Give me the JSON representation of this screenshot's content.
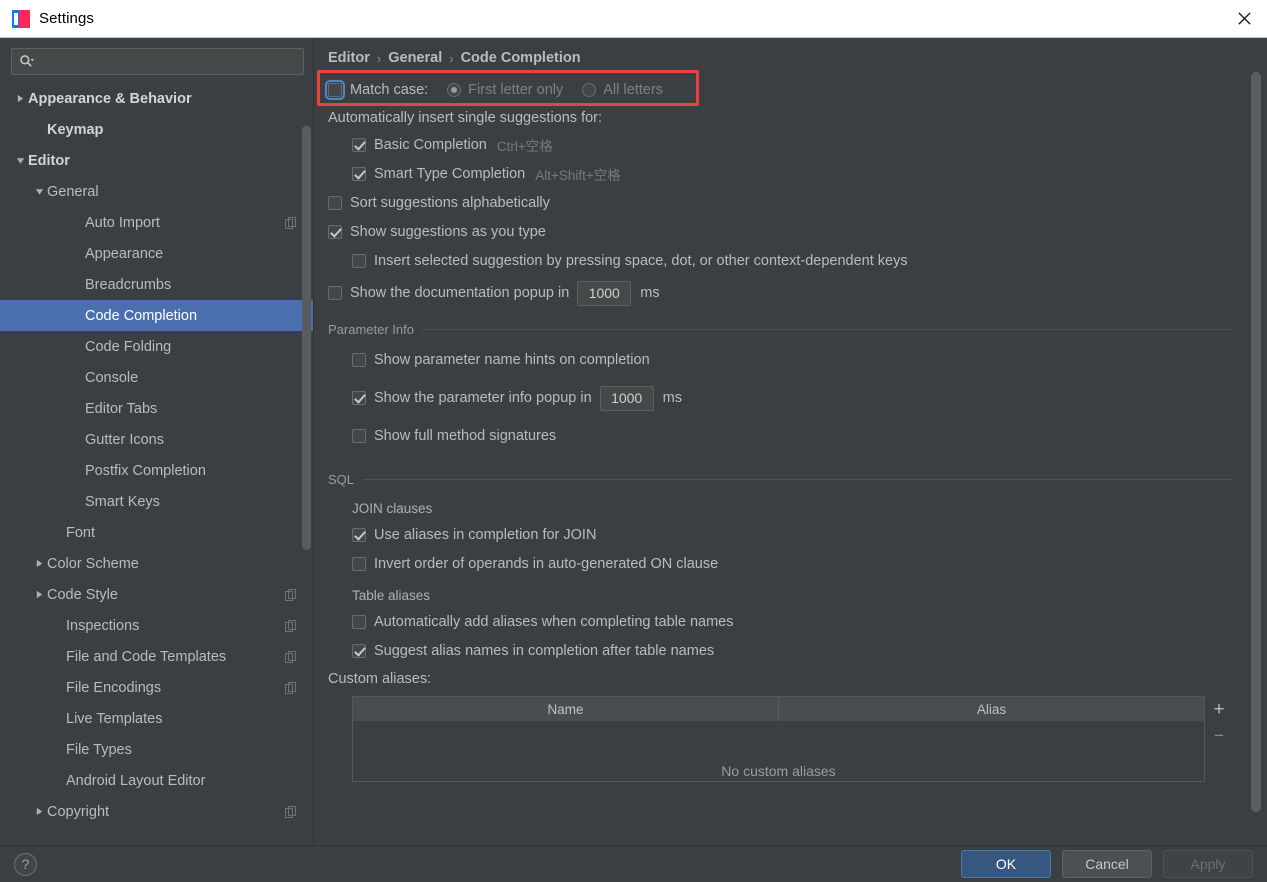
{
  "window": {
    "title": "Settings",
    "app_icon": "intellij-idea-icon",
    "close_icon": "close-icon"
  },
  "sidebar": {
    "search": {
      "placeholder": "",
      "value": "",
      "icon": "search-icon"
    },
    "items": [
      {
        "label": "Appearance & Behavior",
        "indent": 0,
        "twisty": "collapsed",
        "bold": true,
        "selected": false,
        "copyable": false
      },
      {
        "label": "Keymap",
        "indent": 1,
        "twisty": "none",
        "bold": true,
        "selected": false,
        "copyable": false
      },
      {
        "label": "Editor",
        "indent": 0,
        "twisty": "expanded",
        "bold": true,
        "selected": false,
        "copyable": false
      },
      {
        "label": "General",
        "indent": 1,
        "twisty": "expanded",
        "bold": false,
        "selected": false,
        "copyable": false
      },
      {
        "label": "Auto Import",
        "indent": 3,
        "twisty": "none",
        "bold": false,
        "selected": false,
        "copyable": true
      },
      {
        "label": "Appearance",
        "indent": 3,
        "twisty": "none",
        "bold": false,
        "selected": false,
        "copyable": false
      },
      {
        "label": "Breadcrumbs",
        "indent": 3,
        "twisty": "none",
        "bold": false,
        "selected": false,
        "copyable": false
      },
      {
        "label": "Code Completion",
        "indent": 3,
        "twisty": "none",
        "bold": false,
        "selected": true,
        "copyable": false
      },
      {
        "label": "Code Folding",
        "indent": 3,
        "twisty": "none",
        "bold": false,
        "selected": false,
        "copyable": false
      },
      {
        "label": "Console",
        "indent": 3,
        "twisty": "none",
        "bold": false,
        "selected": false,
        "copyable": false
      },
      {
        "label": "Editor Tabs",
        "indent": 3,
        "twisty": "none",
        "bold": false,
        "selected": false,
        "copyable": false
      },
      {
        "label": "Gutter Icons",
        "indent": 3,
        "twisty": "none",
        "bold": false,
        "selected": false,
        "copyable": false
      },
      {
        "label": "Postfix Completion",
        "indent": 3,
        "twisty": "none",
        "bold": false,
        "selected": false,
        "copyable": false
      },
      {
        "label": "Smart Keys",
        "indent": 3,
        "twisty": "none",
        "bold": false,
        "selected": false,
        "copyable": false
      },
      {
        "label": "Font",
        "indent": 2,
        "twisty": "none",
        "bold": false,
        "selected": false,
        "copyable": false
      },
      {
        "label": "Color Scheme",
        "indent": 1,
        "twisty": "collapsed",
        "bold": false,
        "selected": false,
        "copyable": false
      },
      {
        "label": "Code Style",
        "indent": 1,
        "twisty": "collapsed",
        "bold": false,
        "selected": false,
        "copyable": true
      },
      {
        "label": "Inspections",
        "indent": 2,
        "twisty": "none",
        "bold": false,
        "selected": false,
        "copyable": true
      },
      {
        "label": "File and Code Templates",
        "indent": 2,
        "twisty": "none",
        "bold": false,
        "selected": false,
        "copyable": true
      },
      {
        "label": "File Encodings",
        "indent": 2,
        "twisty": "none",
        "bold": false,
        "selected": false,
        "copyable": true
      },
      {
        "label": "Live Templates",
        "indent": 2,
        "twisty": "none",
        "bold": false,
        "selected": false,
        "copyable": false
      },
      {
        "label": "File Types",
        "indent": 2,
        "twisty": "none",
        "bold": false,
        "selected": false,
        "copyable": false
      },
      {
        "label": "Android Layout Editor",
        "indent": 2,
        "twisty": "none",
        "bold": false,
        "selected": false,
        "copyable": false
      },
      {
        "label": "Copyright",
        "indent": 1,
        "twisty": "collapsed",
        "bold": false,
        "selected": false,
        "copyable": true
      }
    ]
  },
  "breadcrumb": {
    "parts": [
      "Editor",
      "General",
      "Code Completion"
    ],
    "separator": "›"
  },
  "main": {
    "match_case": {
      "label": "Match case:",
      "checked": false,
      "focused": true,
      "options": [
        {
          "label": "First letter only",
          "selected": true,
          "disabled": true
        },
        {
          "label": "All letters",
          "selected": false,
          "disabled": true
        }
      ]
    },
    "auto_insert_header": "Automatically insert single suggestions for:",
    "auto_insert_items": [
      {
        "label": "Basic Completion",
        "shortcut": "Ctrl+空格",
        "checked": true
      },
      {
        "label": "Smart Type Completion",
        "shortcut": "Alt+Shift+空格",
        "checked": true
      }
    ],
    "options": [
      {
        "label": "Sort suggestions alphabetically",
        "checked": false
      },
      {
        "label": "Show suggestions as you type",
        "checked": true
      }
    ],
    "insert_selected": {
      "label": "Insert selected suggestion by pressing space, dot, or other context-dependent keys",
      "checked": false
    },
    "doc_popup": {
      "label": "Show the documentation popup in",
      "checked": false,
      "value": "1000",
      "unit": "ms"
    },
    "parameter_info": {
      "title": "Parameter Info",
      "show_hints": {
        "label": "Show parameter name hints on completion",
        "checked": false
      },
      "popup": {
        "label": "Show the parameter info popup in",
        "checked": true,
        "value": "1000",
        "unit": "ms"
      },
      "full_signatures": {
        "label": "Show full method signatures",
        "checked": false
      }
    },
    "sql": {
      "title": "SQL",
      "join_clauses": {
        "title": "JOIN clauses",
        "items": [
          {
            "label": "Use aliases in completion for JOIN",
            "checked": true
          },
          {
            "label": "Invert order of operands in auto-generated ON clause",
            "checked": false
          }
        ]
      },
      "table_aliases": {
        "title": "Table aliases",
        "items": [
          {
            "label": "Automatically add aliases when completing table names",
            "checked": false
          },
          {
            "label": "Suggest alias names in completion after table names",
            "checked": true
          }
        ]
      },
      "custom_aliases": {
        "label": "Custom aliases:",
        "columns": [
          "Name",
          "Alias"
        ],
        "rows": [],
        "empty_text": "No custom aliases",
        "add_button": "+",
        "remove_button": "−"
      }
    }
  },
  "footer": {
    "help_label": "?",
    "ok_label": "OK",
    "cancel_label": "Cancel",
    "apply_label": "Apply",
    "apply_disabled": true
  },
  "colors": {
    "background": "#3c3f41",
    "selection": "#4b6eaf",
    "accent_button": "#365880",
    "annotation": "#e8413f",
    "text": "#bbbbbb",
    "text_dim": "#808080",
    "titlebar": "#ffffff"
  }
}
